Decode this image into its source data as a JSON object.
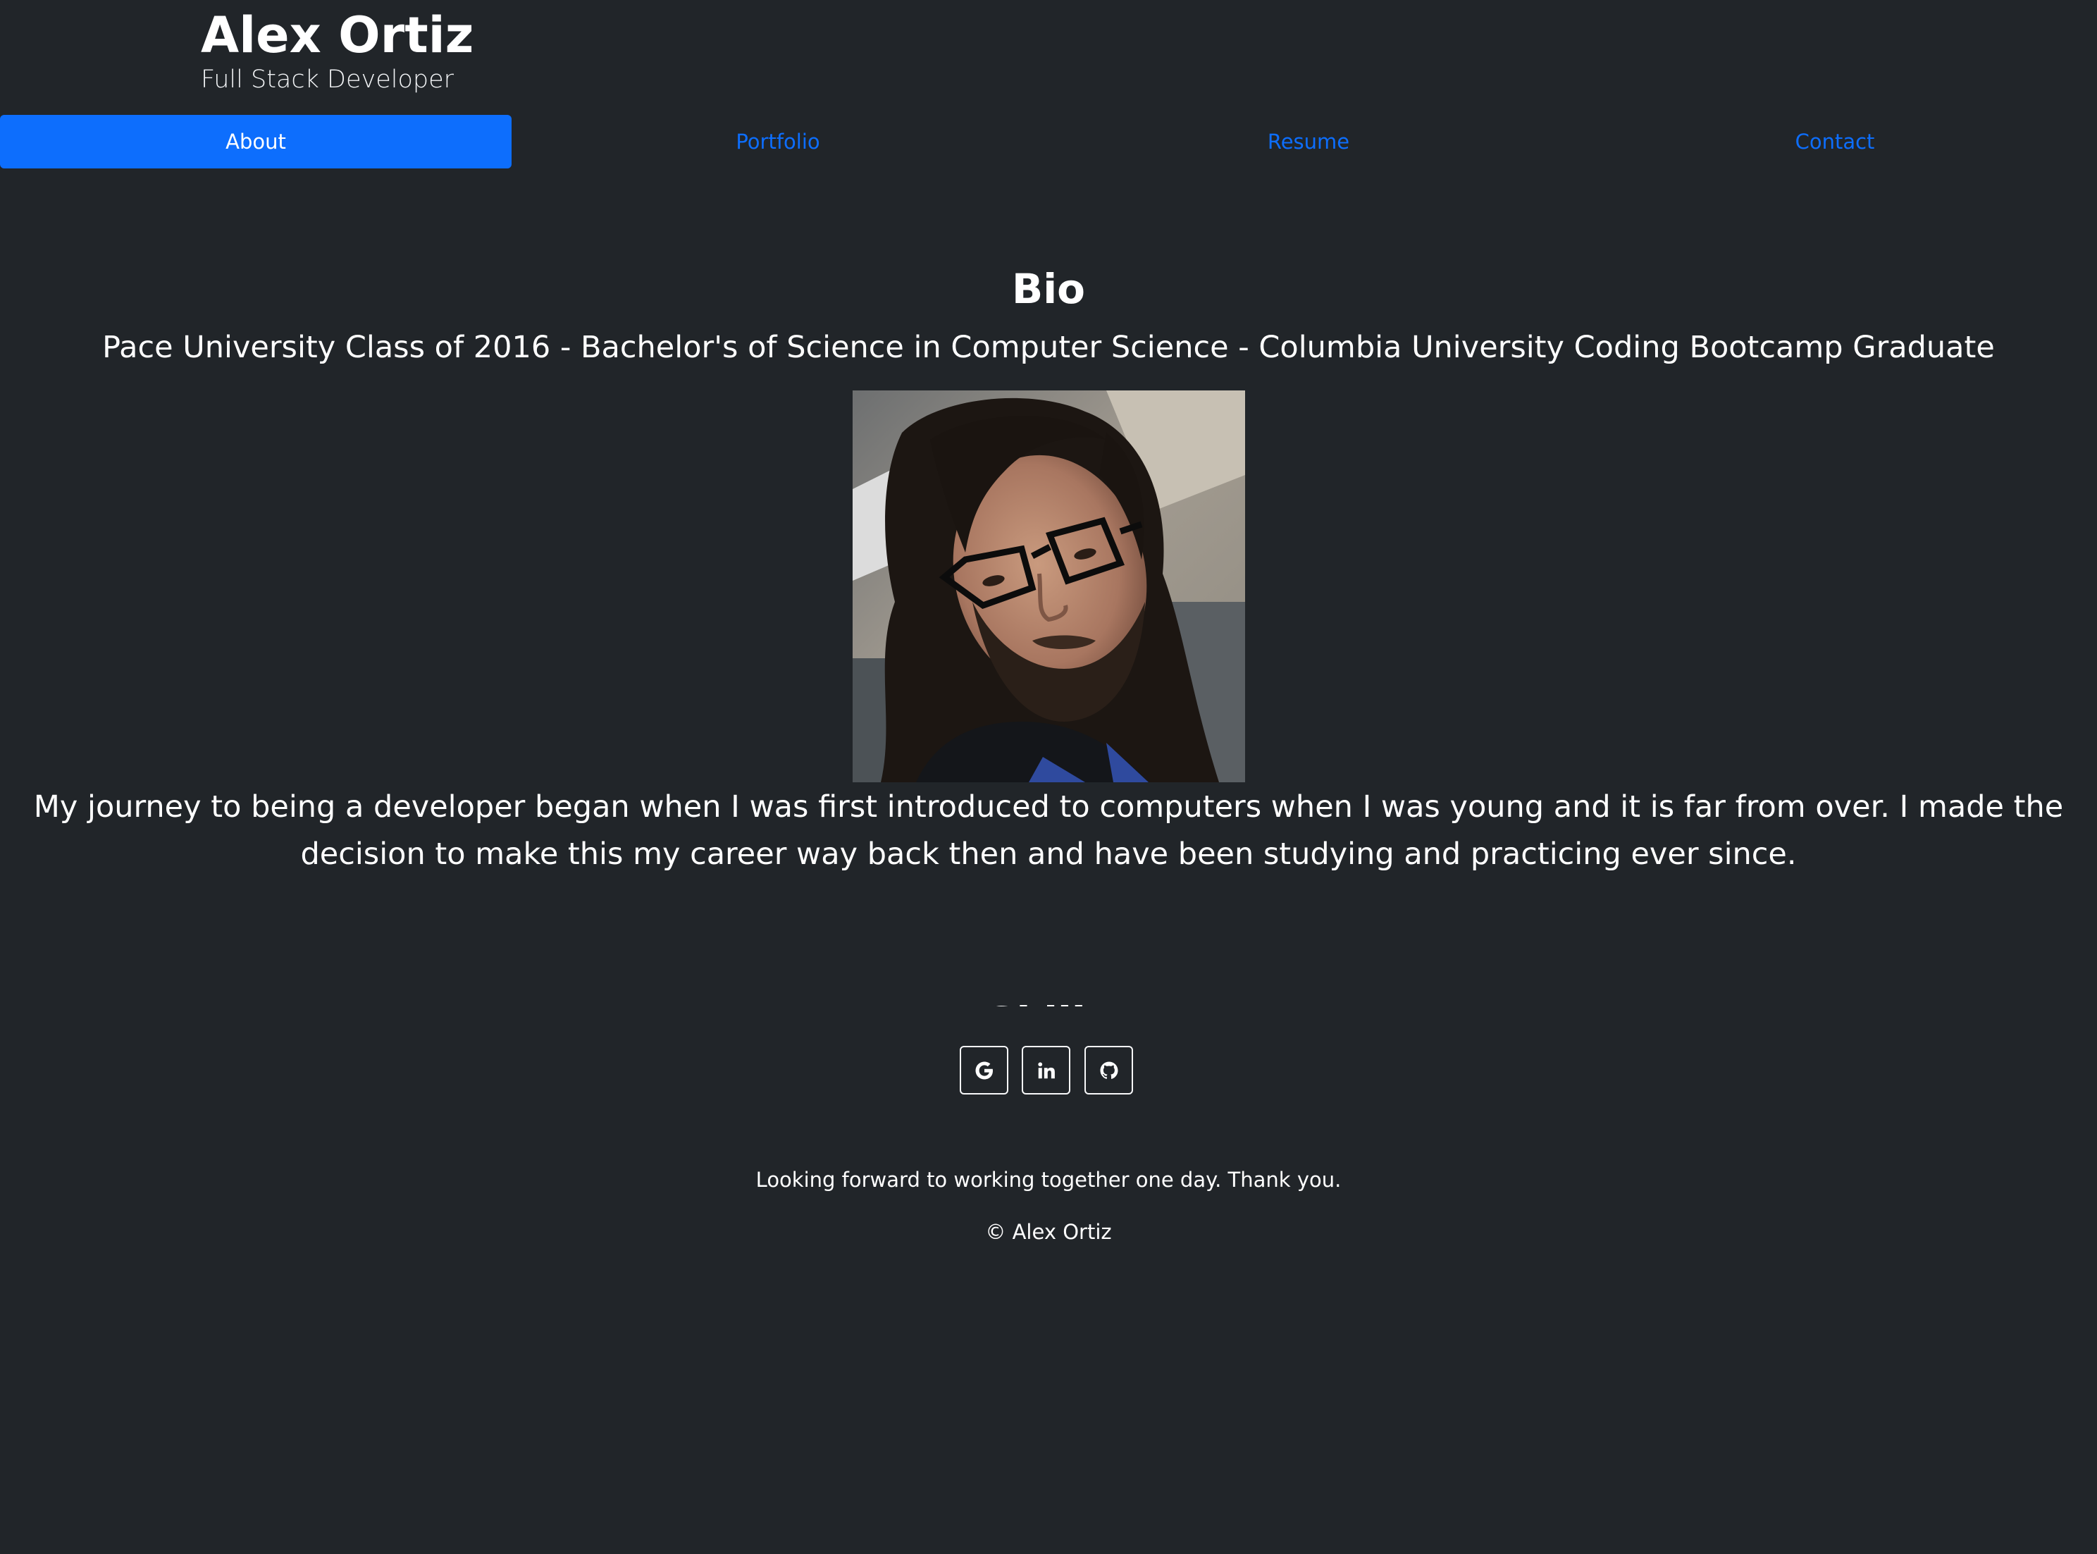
{
  "header": {
    "name": "Alex Ortiz",
    "tagline": "Full Stack Developer"
  },
  "nav": {
    "items": [
      {
        "label": "About",
        "active": true
      },
      {
        "label": "Portfolio",
        "active": false
      },
      {
        "label": "Resume",
        "active": false
      },
      {
        "label": "Contact",
        "active": false
      }
    ]
  },
  "bio": {
    "heading": "Bio",
    "subtitle": "Pace University Class of 2016 - Bachelor's of Science in Computer Science - Columbia University Coding Bootcamp Graduate",
    "photo_alt": "Alex Ortiz",
    "text": "My journey to being a developer began when I was first introduced to computers when I was young and it is far from over. I made the decision to make this my career way back then and have been studying and practicing ever since."
  },
  "skills": {
    "heading": "Skills"
  },
  "social": {
    "buttons": [
      {
        "icon": "google-icon"
      },
      {
        "icon": "linkedin-icon"
      },
      {
        "icon": "github-icon"
      }
    ]
  },
  "footer": {
    "note": "Looking forward to working together one day. Thank you.",
    "copyright": "© Alex Ortiz"
  },
  "colors": {
    "background": "#212529",
    "accent": "#0d6efd",
    "text": "#ffffff"
  }
}
